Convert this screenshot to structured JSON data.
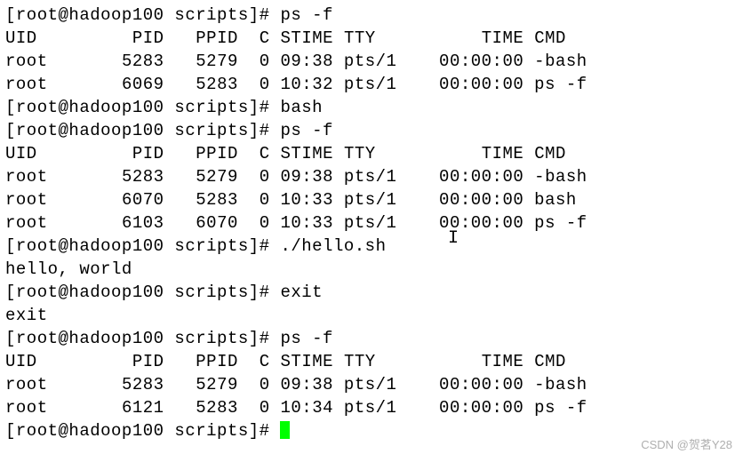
{
  "prompt": "[root@hadoop100 scripts]# ",
  "commands": {
    "ps_f": "ps -f",
    "bash": "bash",
    "hello": "./hello.sh",
    "exit_cmd": "exit"
  },
  "headers": {
    "uid": "UID",
    "pid": "PID",
    "ppid": "PPID",
    "c": "C",
    "stime": "STIME",
    "tty": "TTY",
    "time": "TIME",
    "cmd": "CMD"
  },
  "ps1": [
    {
      "uid": "root",
      "pid": "5283",
      "ppid": "5279",
      "c": "0",
      "stime": "09:38",
      "tty": "pts/1",
      "time": "00:00:00",
      "cmd": "-bash"
    },
    {
      "uid": "root",
      "pid": "6069",
      "ppid": "5283",
      "c": "0",
      "stime": "10:32",
      "tty": "pts/1",
      "time": "00:00:00",
      "cmd": "ps -f"
    }
  ],
  "ps2": [
    {
      "uid": "root",
      "pid": "5283",
      "ppid": "5279",
      "c": "0",
      "stime": "09:38",
      "tty": "pts/1",
      "time": "00:00:00",
      "cmd": "-bash"
    },
    {
      "uid": "root",
      "pid": "6070",
      "ppid": "5283",
      "c": "0",
      "stime": "10:33",
      "tty": "pts/1",
      "time": "00:00:00",
      "cmd": "bash"
    },
    {
      "uid": "root",
      "pid": "6103",
      "ppid": "6070",
      "c": "0",
      "stime": "10:33",
      "tty": "pts/1",
      "time": "00:00:00",
      "cmd": "ps -f"
    }
  ],
  "ps3": [
    {
      "uid": "root",
      "pid": "5283",
      "ppid": "5279",
      "c": "0",
      "stime": "09:38",
      "tty": "pts/1",
      "time": "00:00:00",
      "cmd": "-bash"
    },
    {
      "uid": "root",
      "pid": "6121",
      "ppid": "5283",
      "c": "0",
      "stime": "10:34",
      "tty": "pts/1",
      "time": "00:00:00",
      "cmd": "ps -f"
    }
  ],
  "output": {
    "hello": "hello, world",
    "exit": "exit"
  },
  "watermark": "CSDN @贺茗Y28"
}
